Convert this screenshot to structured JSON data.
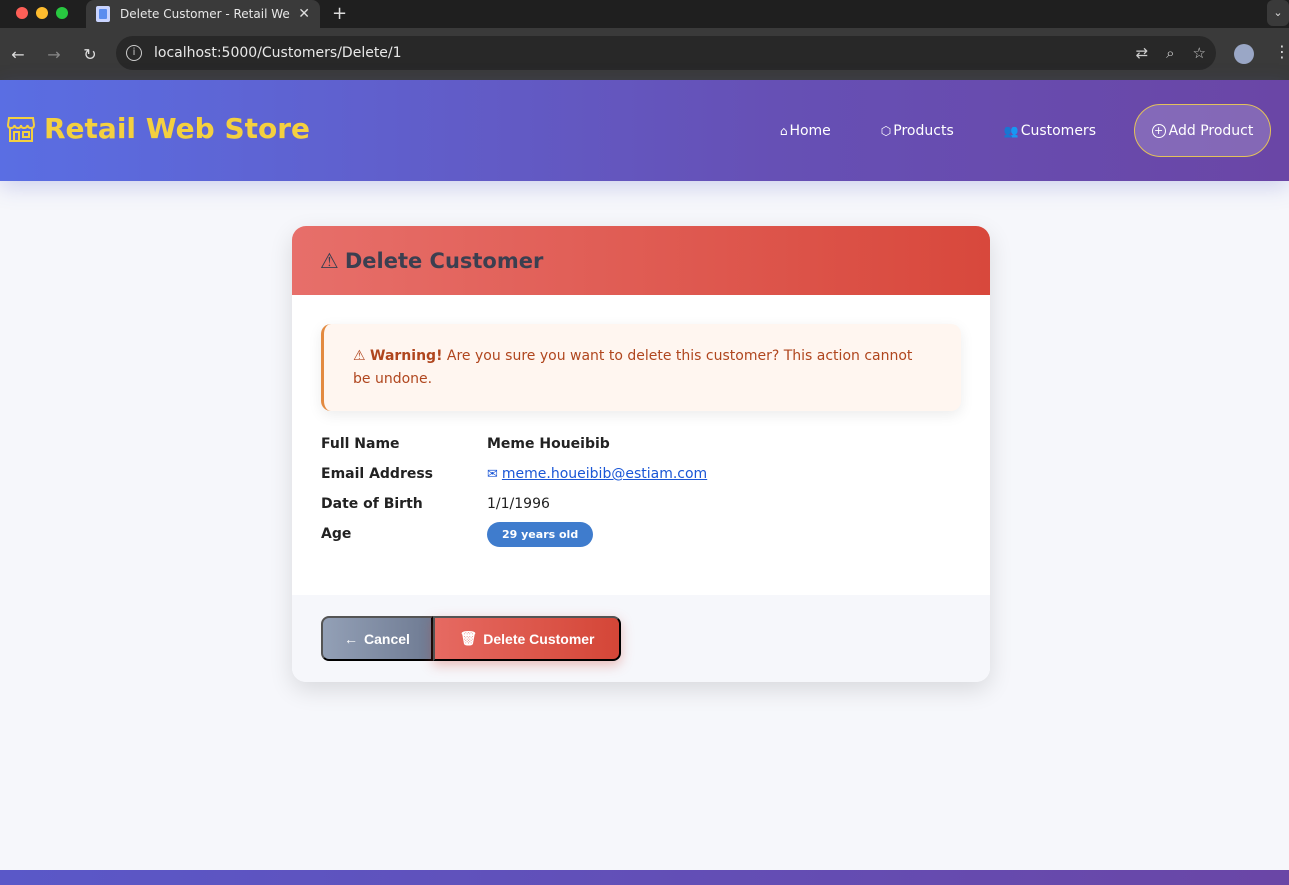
{
  "browser": {
    "tab_title": "Delete Customer - Retail Web",
    "url": "localhost:5000/Customers/Delete/1"
  },
  "site": {
    "brand": "Retail Web Store",
    "nav": {
      "home": "Home",
      "products": "Products",
      "customers": "Customers",
      "add_product": "Add Product"
    }
  },
  "card": {
    "title": "Delete Customer",
    "warning_title": "Warning!",
    "warning_text": "Are you sure you want to delete this customer? This action cannot be undone.",
    "fields": {
      "full_name_label": "Full Name",
      "full_name": "Meme Houeibib",
      "email_label": "Email Address",
      "email": "meme.houeibib@estiam.com",
      "dob_label": "Date of Birth",
      "dob": "1/1/1996",
      "age_label": "Age",
      "age": "29 years old"
    },
    "buttons": {
      "cancel": "Cancel",
      "delete": "Delete Customer"
    }
  },
  "colors": {
    "brand_yellow": "#f4d03f",
    "header_start": "#5a6ee3",
    "header_end": "#6a46a6",
    "danger": "#d8483c",
    "warning_border": "#e38a40",
    "badge": "#3f7ccd"
  }
}
